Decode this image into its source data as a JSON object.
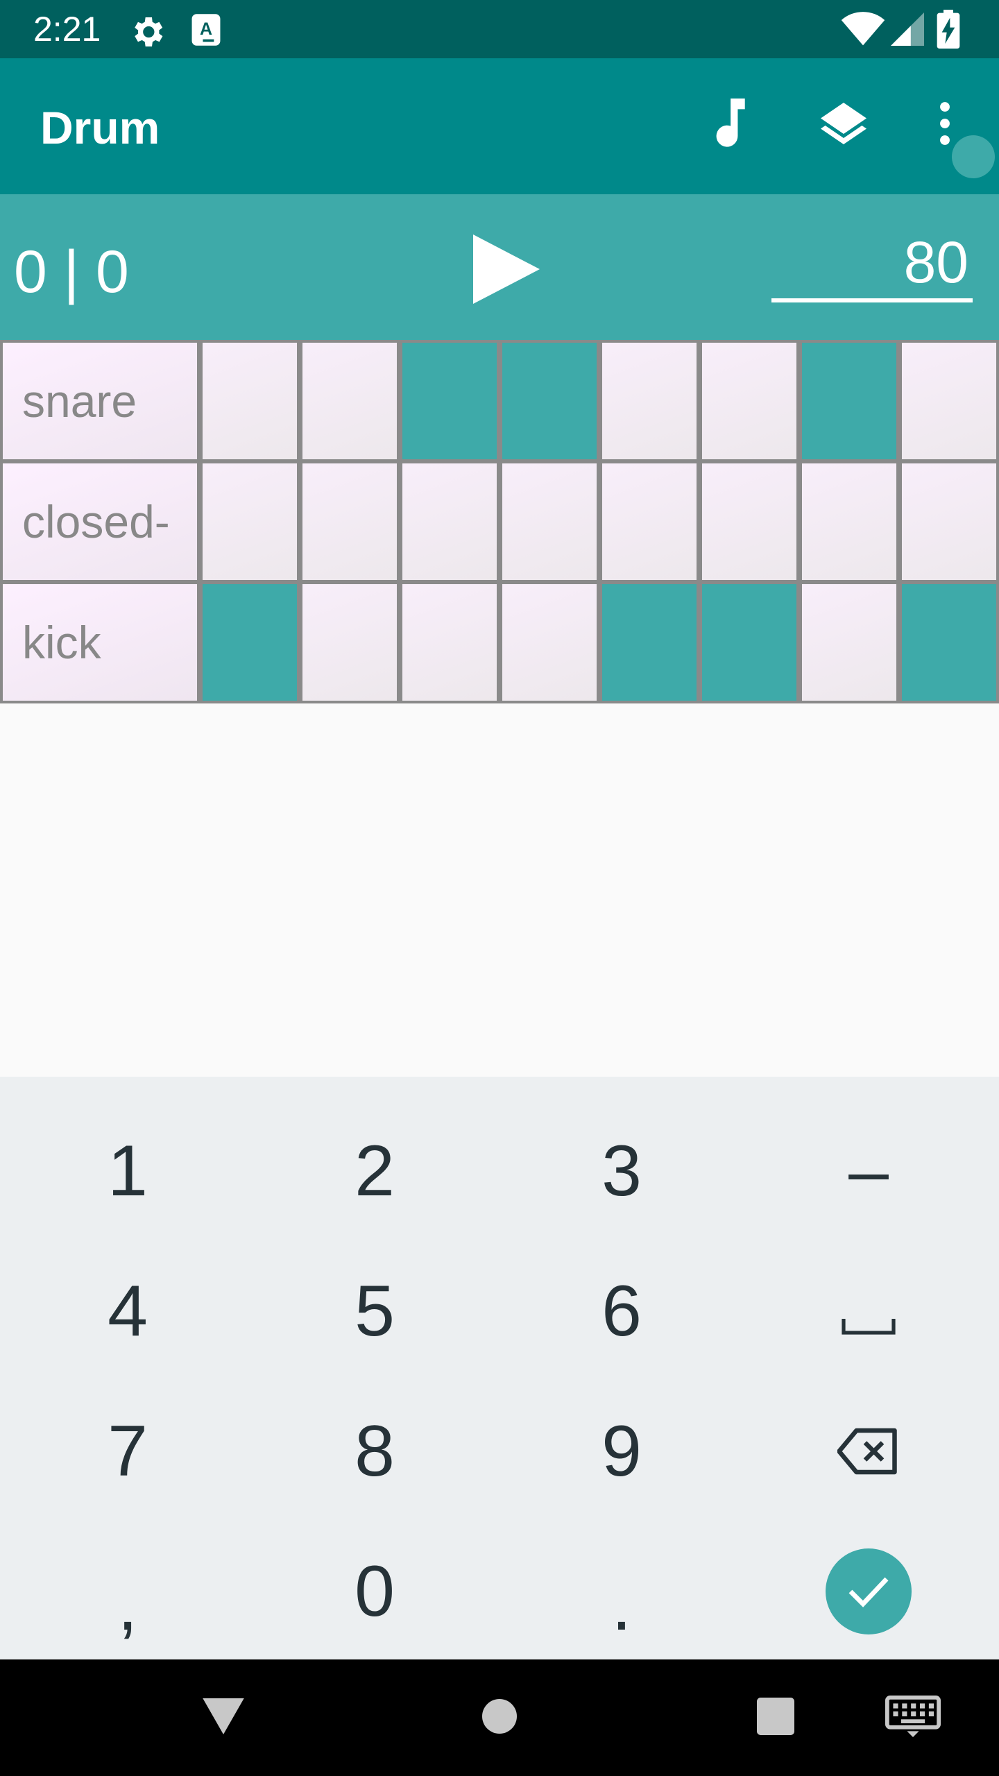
{
  "status_bar": {
    "time": "2:21"
  },
  "app_bar": {
    "title": "Drum"
  },
  "transport": {
    "position": "0 | 0",
    "tempo": "80"
  },
  "grid": {
    "rows": [
      {
        "label": "snare",
        "steps": [
          false,
          false,
          true,
          true,
          false,
          false,
          true,
          false
        ]
      },
      {
        "label": "closed-",
        "steps": [
          false,
          false,
          false,
          false,
          false,
          false,
          false,
          false
        ]
      },
      {
        "label": "kick",
        "steps": [
          true,
          false,
          false,
          false,
          true,
          true,
          false,
          true
        ]
      }
    ]
  },
  "keyboard": {
    "keys": [
      [
        "1",
        "2",
        "3",
        "–"
      ],
      [
        "4",
        "5",
        "6",
        "space"
      ],
      [
        "7",
        "8",
        "9",
        "backspace"
      ],
      [
        ",",
        "0",
        ".",
        "done"
      ]
    ]
  },
  "colors": {
    "status_bar": "#00605e",
    "app_bar": "#00898a",
    "accent": "#3eaaa9",
    "keyboard": "#eceff1"
  }
}
